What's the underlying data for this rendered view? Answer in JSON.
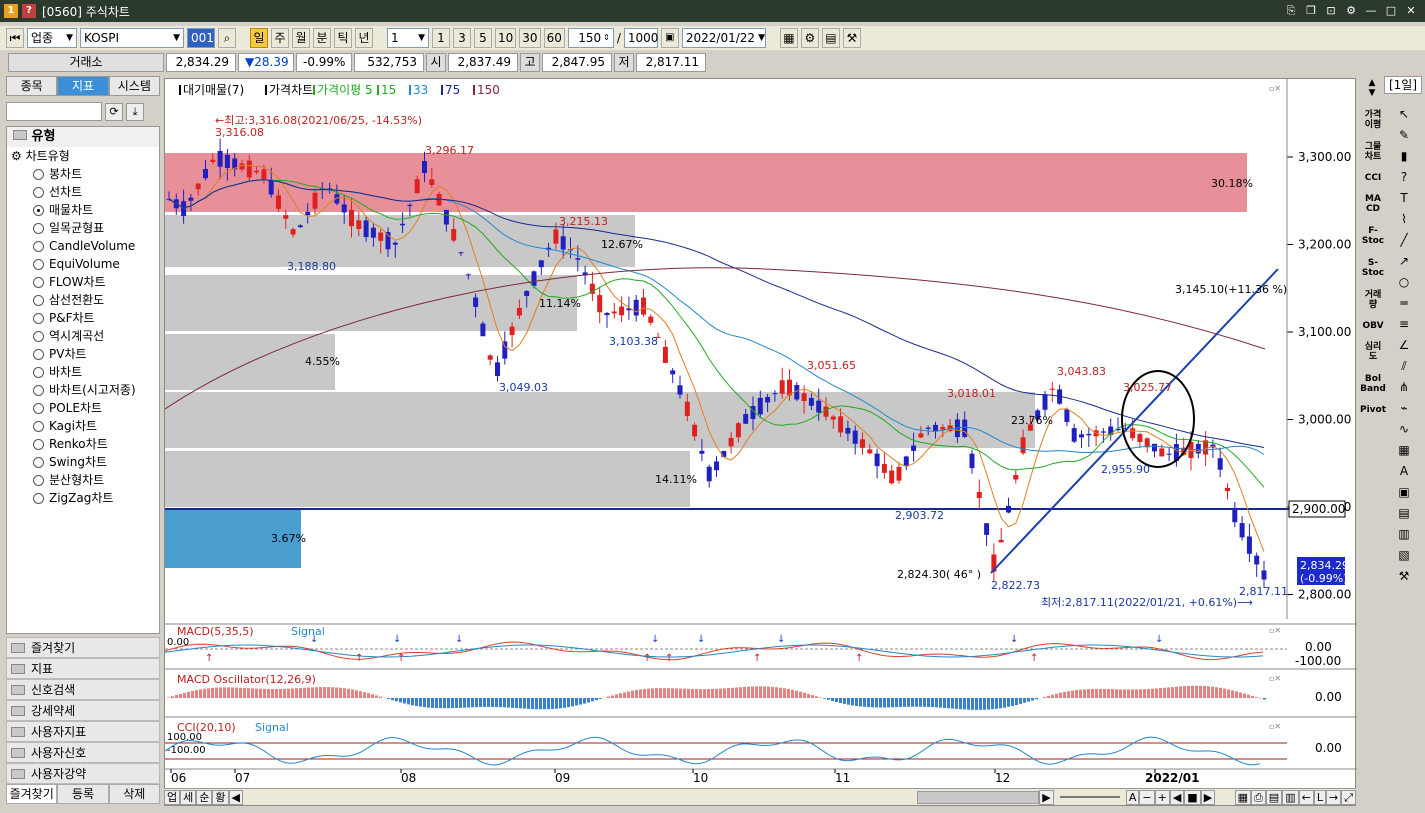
{
  "window": {
    "code": "[0560]",
    "title": "주식차트",
    "icons": [
      "1",
      "?"
    ]
  },
  "toolbar": {
    "sector": "업종",
    "index": "KOSPI",
    "code": "001",
    "periods": [
      "일",
      "주",
      "월",
      "분",
      "틱",
      "년"
    ],
    "active_period": "일",
    "multiplier": "1",
    "ranges": [
      "1",
      "3",
      "5",
      "10",
      "30",
      "60"
    ],
    "count": "150",
    "slash": "/",
    "total": "1000",
    "date": "2022/01/22"
  },
  "quote": {
    "exchange": "거래소",
    "price": "2,834.29",
    "change": "▼28.39",
    "change_pct": "-0.99%",
    "volume": "532,753",
    "open_label": "시",
    "open": "2,837.49",
    "high_label": "고",
    "high": "2,847.95",
    "low_label": "저",
    "low": "2,817.11",
    "period_tag": "[1일]"
  },
  "left": {
    "tabs": [
      "종목",
      "지표",
      "시스템"
    ],
    "active_tab": "지표",
    "group": "유형",
    "subgroup": "차트유형",
    "chart_types": [
      "봉차트",
      "선차트",
      "매물차트",
      "일목균형표",
      "CandleVolume",
      "EquiVolume",
      "FLOW차트",
      "삼선전환도",
      "P&F차트",
      "역시계곡선",
      "PV차트",
      "바차트",
      "바차트(시고저종)",
      "POLE차트",
      "Kagi차트",
      "Renko차트",
      "Swing차트",
      "분산형차트",
      "ZigZag차트"
    ],
    "selected_type": "매물차트",
    "folders": [
      "즐겨찾기",
      "지표",
      "신호검색",
      "강세약세",
      "사용자지표",
      "사용자신호",
      "사용자강약"
    ],
    "bottom_tabs": [
      "즐겨찾기",
      "등록",
      "삭제"
    ]
  },
  "chart": {
    "legend": [
      "대기매물(7)",
      "가격차트",
      "가격이평 5",
      "15",
      "33",
      "75",
      "150"
    ],
    "legend_colors": [
      "#000000",
      "#000000",
      "#22aa22",
      "#22aa22",
      "#2288cc",
      "#1a2a8a",
      "#7a2a3a"
    ],
    "annotations": {
      "high": "최고:3,316.08(2021/06/25, -14.53%)",
      "high_val": "3,316.08",
      "low": "최저:2,817.11(2022/01/21, +0.61%)",
      "p1": "3,296.17",
      "p2": "3,215.13",
      "p3": "3,188.80",
      "p4": "3,103.38",
      "p5": "3,049.03",
      "p6": "3,051.65",
      "p7": "3,018.01",
      "p8": "3,043.83",
      "p9": "3,025.77",
      "p10": "2,955.90",
      "p11": "2,903.72",
      "p12": "2,822.73",
      "p13": "2,817.11",
      "trend": "3,145.10(+11.36 %)",
      "angle": "2,824.30( 46° )",
      "pct1": "30.18%",
      "pct2": "12.67%",
      "pct3": "11.14%",
      "pct4": "4.55%",
      "pct5": "23.76%",
      "pct6": "14.11%",
      "pct7": "3.67%"
    },
    "yaxis": [
      "3,300.00",
      "3,200.00",
      "3,100.00",
      "3,000.00",
      "2,900.00",
      "2,800.00"
    ],
    "hline_label": "2,900.00",
    "last_price": "2,834.29",
    "last_pct": "(-0.99%)",
    "xaxis": [
      "06",
      "07",
      "08",
      "09",
      "10",
      "11",
      "12",
      "2022/01"
    ],
    "macd_title": "MACD(5,35,5)",
    "macd_signal": "Signal",
    "macd_y": [
      "0.00",
      "-100.00"
    ],
    "macd_left": "0.00",
    "osc_title": "MACD Oscillator(12,26,9)",
    "osc_y": "0.00",
    "cci_title": "CCI(20,10)",
    "cci_signal": "Signal",
    "cci_y": "0.00",
    "cci_left1": "100.00",
    "cci_left2": "-100.00"
  },
  "right_indicators": [
    "가격\n이평",
    "그물\n차트",
    "CCI",
    "MA\nCD",
    "F-\nStoc",
    "S-\nStoc",
    "거래\n량",
    "OBV",
    "심리\n도",
    "Bol\nBand",
    "Pivot"
  ],
  "bottom": {
    "tabs": [
      "업",
      "세",
      "순",
      "황"
    ]
  }
}
